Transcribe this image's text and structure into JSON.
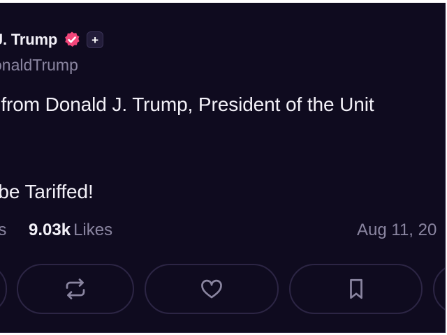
{
  "post": {
    "author": {
      "display_name": "J. Trump",
      "handle": "onaldTrump",
      "verified_icon": "verified-badge-icon",
      "plus_icon": "plus-icon",
      "plus_symbol": "+"
    },
    "text_lines": [
      ": from Donald J. Trump, President of the Unit",
      ": be Tariffed!"
    ],
    "stats": {
      "reposts_label_fragment": "ns",
      "likes_count": "9.03k",
      "likes_label": "Likes",
      "date": "Aug 11, 20"
    },
    "actions": [
      {
        "name": "repost",
        "icon": "repost-icon"
      },
      {
        "name": "like",
        "icon": "heart-icon"
      },
      {
        "name": "bookmark",
        "icon": "bookmark-icon"
      }
    ]
  },
  "colors": {
    "background": "#0f0b1f",
    "text": "#f3f1f8",
    "muted": "#8a85a0",
    "verified": "#f2467a",
    "button_border": "#2c2544"
  }
}
